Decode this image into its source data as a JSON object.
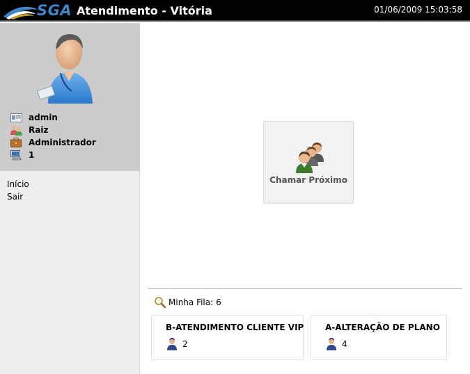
{
  "header": {
    "logo_text": "SGA",
    "title": "Atendimento - Vitória",
    "datetime": "01/06/2009 15:03:58"
  },
  "user": {
    "name": "admin",
    "unit": "Raiz",
    "role": "Administrador",
    "desk": "1"
  },
  "nav": [
    {
      "label": "Início"
    },
    {
      "label": "Sair"
    }
  ],
  "main": {
    "call_next_label": "Chamar Próximo",
    "queue_label": "Minha Fila:",
    "queue_total": "6",
    "queues": [
      {
        "name": "B-ATENDIMENTO CLIENTE VIP",
        "count": "2"
      },
      {
        "name": "A-ALTERAÇÃO DE PLANO",
        "count": "4"
      }
    ]
  },
  "colors": {
    "topbar": "#000000",
    "logo": "#3f86c8",
    "user_panel": "#cccccc",
    "sidebar": "#efefef",
    "button_bg": "#f2f2f2"
  },
  "icons": {
    "logo": "sga-wave-logo",
    "avatar": "user-avatar",
    "name": "id-card-icon",
    "unit": "group-icon",
    "role": "briefcase-icon",
    "desk": "computer-icon",
    "call": "people-group-icon",
    "search": "magnifier-icon",
    "queue": "person-icon"
  }
}
